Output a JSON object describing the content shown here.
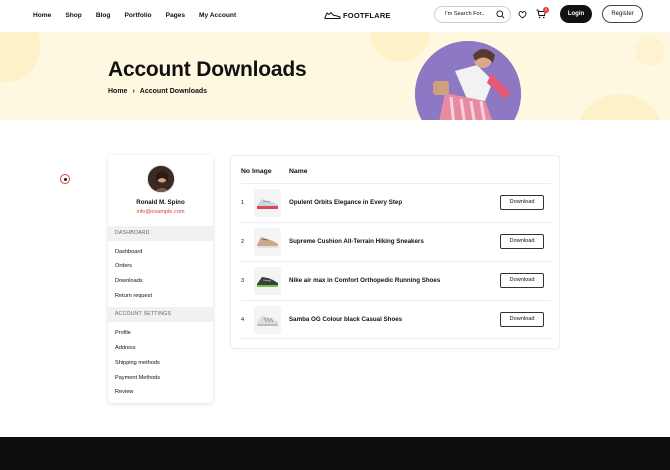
{
  "nav": {
    "items": [
      "Home",
      "Shop",
      "Blog",
      "Portfolio",
      "Pages",
      "My Account"
    ]
  },
  "logo": {
    "text_a": "FOOT",
    "text_b": "FLARE"
  },
  "search": {
    "placeholder": "I'm Search For.."
  },
  "cart": {
    "badge": "0"
  },
  "auth": {
    "login": "Login",
    "register": "Register"
  },
  "hero": {
    "title": "Account Downloads",
    "breadcrumb": [
      "Home",
      "Account Downloads"
    ],
    "breadcrumb_sep": "›"
  },
  "profile": {
    "name": "Ronald M. Spino",
    "email": "info@example.com"
  },
  "sidebar": {
    "dashboard_heading": "DASHBOARD",
    "dashboard_items": [
      "Dashboard",
      "Orders",
      "Downloads",
      "Return request"
    ],
    "settings_heading": "ACCOUNT SETTINGS",
    "settings_items": [
      "Profile",
      "Address",
      "Shipping methods",
      "Payment Methods",
      "Review"
    ]
  },
  "downloads": {
    "col_no_image": "No Image",
    "col_name": "Name",
    "button_label": "Download",
    "rows": [
      {
        "num": "1",
        "name": "Opulent Orbits Elegance in Every Step"
      },
      {
        "num": "2",
        "name": "Supreme Cushion All-Terrain Hiking Sneakers"
      },
      {
        "num": "3",
        "name": "Nike air max in Comfort Orthopedic Running Shoes"
      },
      {
        "num": "4",
        "name": "Samba OG Colour black Casual Shoes"
      }
    ]
  },
  "colors": {
    "accent": "#e53935",
    "hero_bg": "#fff8e1",
    "footer_bg": "#0d0d0d",
    "hero_circle": "#8d78c4"
  }
}
